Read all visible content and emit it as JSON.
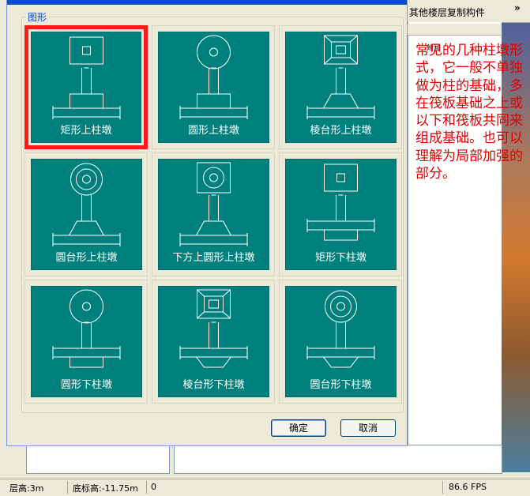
{
  "toolbar": {
    "label": "其他楼层复制构件",
    "overflow": "»"
  },
  "right_panel": {
    "mini_label": "附加"
  },
  "annotation": "常见的几种柱墩形式，它一般不单独做为柱的基础，多在筏板基础之上或以下和筏板共同来组成基础。也可以理解为局部加强的部分。",
  "dialog": {
    "group_label": "图形",
    "selected_index": 0,
    "tiles": [
      {
        "label": "矩形上柱墩",
        "head": "rect",
        "position": "up",
        "pier": "rect"
      },
      {
        "label": "圆形上柱墩",
        "head": "circle",
        "position": "up",
        "pier": "rect"
      },
      {
        "label": "棱台形上柱墩",
        "head": "frustum",
        "position": "up",
        "pier": "trap"
      },
      {
        "label": "圆台形上柱墩",
        "head": "ring",
        "position": "up",
        "pier": "trap"
      },
      {
        "label": "下方上圆形上柱墩",
        "head": "rect-circle",
        "position": "up",
        "pier": "trap"
      },
      {
        "label": "矩形下柱墩",
        "head": "rect",
        "position": "down",
        "pier": "rect"
      },
      {
        "label": "圆形下柱墩",
        "head": "circle",
        "position": "down",
        "pier": "rect"
      },
      {
        "label": "棱台形下柱墩",
        "head": "frustum",
        "position": "down",
        "pier": "trap"
      },
      {
        "label": "圆台形下柱墩",
        "head": "ring",
        "position": "down",
        "pier": "trap"
      }
    ],
    "ok_label": "确定",
    "cancel_label": "取消"
  },
  "status": {
    "floor_height": "层高:3m",
    "bottom_elev": "底标高:-11.75m",
    "value": "0",
    "fps": "86.6 FPS"
  },
  "colors": {
    "tile_bg": "#00807d",
    "selection": "#ff1a1a",
    "annotation": "#e00000"
  }
}
